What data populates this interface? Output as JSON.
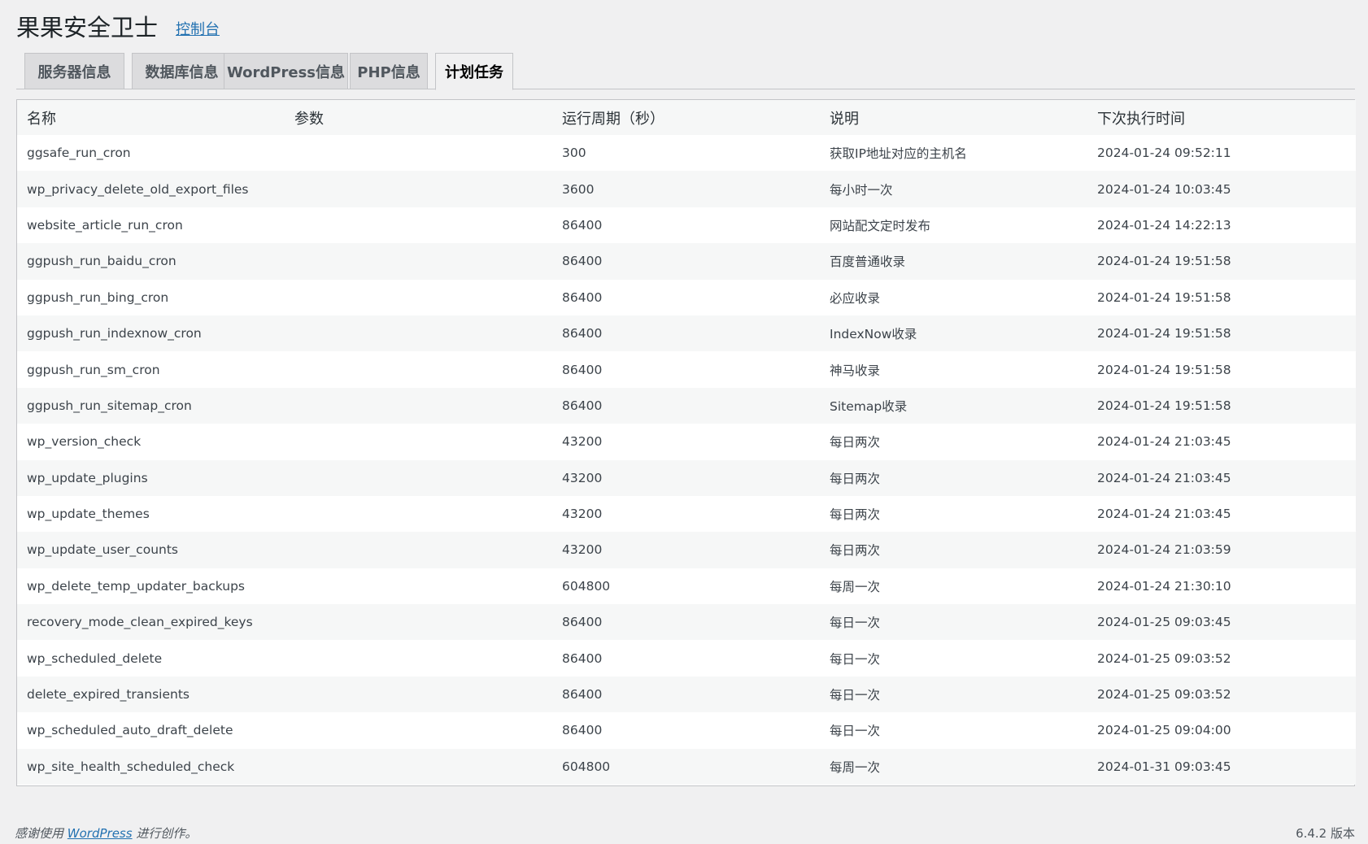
{
  "header": {
    "title": "果果安全卫士",
    "link_label": "控制台"
  },
  "tabs": [
    {
      "label": "服务器信息",
      "active": false
    },
    {
      "label": "数据库信息",
      "active": false
    },
    {
      "label": "WordPress信息",
      "active": false
    },
    {
      "label": "PHP信息",
      "active": false
    },
    {
      "label": "计划任务",
      "active": true
    }
  ],
  "table": {
    "columns": [
      "名称",
      "参数",
      "运行周期（秒）",
      "说明",
      "下次执行时间"
    ],
    "rows": [
      {
        "name": "ggsafe_run_cron",
        "args": "",
        "period": "300",
        "desc": "获取IP地址对应的主机名",
        "next": "2024-01-24 09:52:11"
      },
      {
        "name": "wp_privacy_delete_old_export_files",
        "args": "",
        "period": "3600",
        "desc": "每小时一次",
        "next": "2024-01-24 10:03:45"
      },
      {
        "name": "website_article_run_cron",
        "args": "",
        "period": "86400",
        "desc": "网站配文定时发布",
        "next": "2024-01-24 14:22:13"
      },
      {
        "name": "ggpush_run_baidu_cron",
        "args": "",
        "period": "86400",
        "desc": "百度普通收录",
        "next": "2024-01-24 19:51:58"
      },
      {
        "name": "ggpush_run_bing_cron",
        "args": "",
        "period": "86400",
        "desc": "必应收录",
        "next": "2024-01-24 19:51:58"
      },
      {
        "name": "ggpush_run_indexnow_cron",
        "args": "",
        "period": "86400",
        "desc": "IndexNow收录",
        "next": "2024-01-24 19:51:58"
      },
      {
        "name": "ggpush_run_sm_cron",
        "args": "",
        "period": "86400",
        "desc": "神马收录",
        "next": "2024-01-24 19:51:58"
      },
      {
        "name": "ggpush_run_sitemap_cron",
        "args": "",
        "period": "86400",
        "desc": "Sitemap收录",
        "next": "2024-01-24 19:51:58"
      },
      {
        "name": "wp_version_check",
        "args": "",
        "period": "43200",
        "desc": "每日两次",
        "next": "2024-01-24 21:03:45"
      },
      {
        "name": "wp_update_plugins",
        "args": "",
        "period": "43200",
        "desc": "每日两次",
        "next": "2024-01-24 21:03:45"
      },
      {
        "name": "wp_update_themes",
        "args": "",
        "period": "43200",
        "desc": "每日两次",
        "next": "2024-01-24 21:03:45"
      },
      {
        "name": "wp_update_user_counts",
        "args": "",
        "period": "43200",
        "desc": "每日两次",
        "next": "2024-01-24 21:03:59"
      },
      {
        "name": "wp_delete_temp_updater_backups",
        "args": "",
        "period": "604800",
        "desc": "每周一次",
        "next": "2024-01-24 21:30:10"
      },
      {
        "name": "recovery_mode_clean_expired_keys",
        "args": "",
        "period": "86400",
        "desc": "每日一次",
        "next": "2024-01-25 09:03:45"
      },
      {
        "name": "wp_scheduled_delete",
        "args": "",
        "period": "86400",
        "desc": "每日一次",
        "next": "2024-01-25 09:03:52"
      },
      {
        "name": "delete_expired_transients",
        "args": "",
        "period": "86400",
        "desc": "每日一次",
        "next": "2024-01-25 09:03:52"
      },
      {
        "name": "wp_scheduled_auto_draft_delete",
        "args": "",
        "period": "86400",
        "desc": "每日一次",
        "next": "2024-01-25 09:04:00"
      },
      {
        "name": "wp_site_health_scheduled_check",
        "args": "",
        "period": "604800",
        "desc": "每周一次",
        "next": "2024-01-31 09:03:45"
      }
    ]
  },
  "footer": {
    "prefix": "感谢使用",
    "link": "WordPress",
    "suffix": "进行创作。",
    "version": "6.4.2 版本"
  }
}
